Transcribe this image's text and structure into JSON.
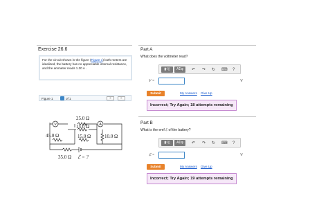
{
  "left": {
    "exercise_title": "Exercise 26.6",
    "problem_before_link": "For the circuit shown in the figure (",
    "problem_link": "Figure 1",
    "problem_after_link": ") both meters are idealized, the battery has no appreciable internal resistance, and the ammeter reads 1.30  A .",
    "figure_label": "Figure 1",
    "figure_of": "of 1",
    "prev_icon": "<",
    "next_icon": ">"
  },
  "circuit": {
    "r_top": "25.0 Ω",
    "r_mid": "15.0 Ω",
    "r_left": "45.0 Ω",
    "r_center": "15.0 Ω",
    "r_right": "10.0 Ω",
    "r_bottom": "35.0 Ω",
    "emf_label": "ℰ = ?",
    "voltmeter": "V",
    "ammeter": "A"
  },
  "partA": {
    "title": "Part A",
    "question": "What does the voltmeter read?",
    "answer_label": "V =",
    "answer_value": "",
    "unit": "V",
    "submit": "Submit",
    "my_answers": "My Answers",
    "give_up": "Give Up",
    "feedback": "Incorrect; Try Again; 18 attempts remaining"
  },
  "partB": {
    "title": "Part B",
    "question": "What is the emf ℰ of the battery?",
    "answer_label": "ℰ =",
    "answer_value": "",
    "unit": "V",
    "submit": "Submit",
    "my_answers": "My Answers",
    "give_up": "Give Up",
    "feedback": "Incorrect; Try Again; 19 attempts remaining"
  },
  "toolbar": {
    "template_btn": "▮√▯",
    "greek_btn": "ΑΣφ",
    "undo_icon": "↶",
    "redo_icon": "↷",
    "reset_icon": "↻",
    "keyboard_icon": "⌨",
    "help_icon": "?"
  },
  "colors": {
    "accent_blue": "#3d86c6",
    "submit_orange": "#e8822a",
    "feedback_bg": "#f6e8f8",
    "feedback_border": "#c58ad1"
  }
}
